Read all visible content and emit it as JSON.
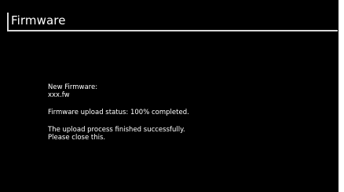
{
  "window": {
    "title": "Firmware"
  },
  "firmware": {
    "new_firmware_label": "New Firmware:",
    "file_name": "xxx.fw"
  },
  "upload": {
    "status_text": "Firmware upload status: 100% completed."
  },
  "message": {
    "line1": "The upload process finished successfully.",
    "line2": "Please close this."
  },
  "colors": {
    "background": "#000000",
    "text": "#ffffff",
    "title_border": "#d8d8d8"
  }
}
